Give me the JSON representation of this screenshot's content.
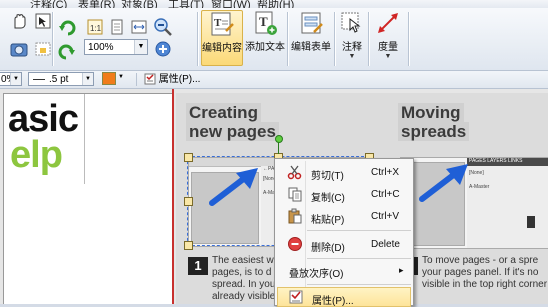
{
  "menubar": {
    "items": [
      "注释(C)",
      "表单(R)",
      "对象(B)",
      "工具(T)",
      "窗口(W)",
      "帮助(H)"
    ]
  },
  "ribbon": {
    "zoom_value": "100%",
    "buttons": {
      "edit_content": "编辑内容",
      "add_text": "添加文本",
      "edit_form": "编辑表单",
      "annotation": "注释",
      "measure": "度量"
    }
  },
  "propbar": {
    "percent": "0%",
    "line_width": ".5 pt",
    "properties_label": "属性(P)..."
  },
  "document": {
    "logo_line1": "asic",
    "logo_line2": "elp",
    "heading1_line1": "Creating",
    "heading1_line2": "new pages",
    "heading2_line1": "Moving",
    "heading2_line2": "spreads",
    "step1": "1",
    "step2": "2",
    "text1": "The easiest w\npages, is to d\nspread. In your page\nalready visible in the",
    "text2": "To move pages - or a spre\nyour pages panel. If it's no\nvisible in the top right corner of",
    "panel_label1": "←PAGES",
    "panel_label2": "PAGES   LAYERS   LINKS",
    "panel_none": "[None]",
    "panel_master": "A-Master"
  },
  "context_menu": {
    "items": [
      {
        "label": "剪切(T)",
        "shortcut": "Ctrl+X",
        "icon": "scissors-icon"
      },
      {
        "label": "复制(C)",
        "shortcut": "Ctrl+C",
        "icon": "copy-icon"
      },
      {
        "label": "粘贴(P)",
        "shortcut": "Ctrl+V",
        "icon": "paste-icon"
      },
      {
        "label": "删除(D)",
        "shortcut": "Delete",
        "icon": "delete-icon"
      },
      {
        "label": "叠放次序(O)",
        "shortcut": "",
        "icon": ""
      },
      {
        "label": "属性(P)...",
        "shortcut": "",
        "icon": "properties-icon"
      }
    ],
    "submenu_arrow": "▸"
  },
  "colors": {
    "accent_green": "#8dc63f",
    "arrow_blue": "#1f5fd6",
    "selection_blue": "#3a6fd8",
    "highlight": "#fde49a"
  }
}
